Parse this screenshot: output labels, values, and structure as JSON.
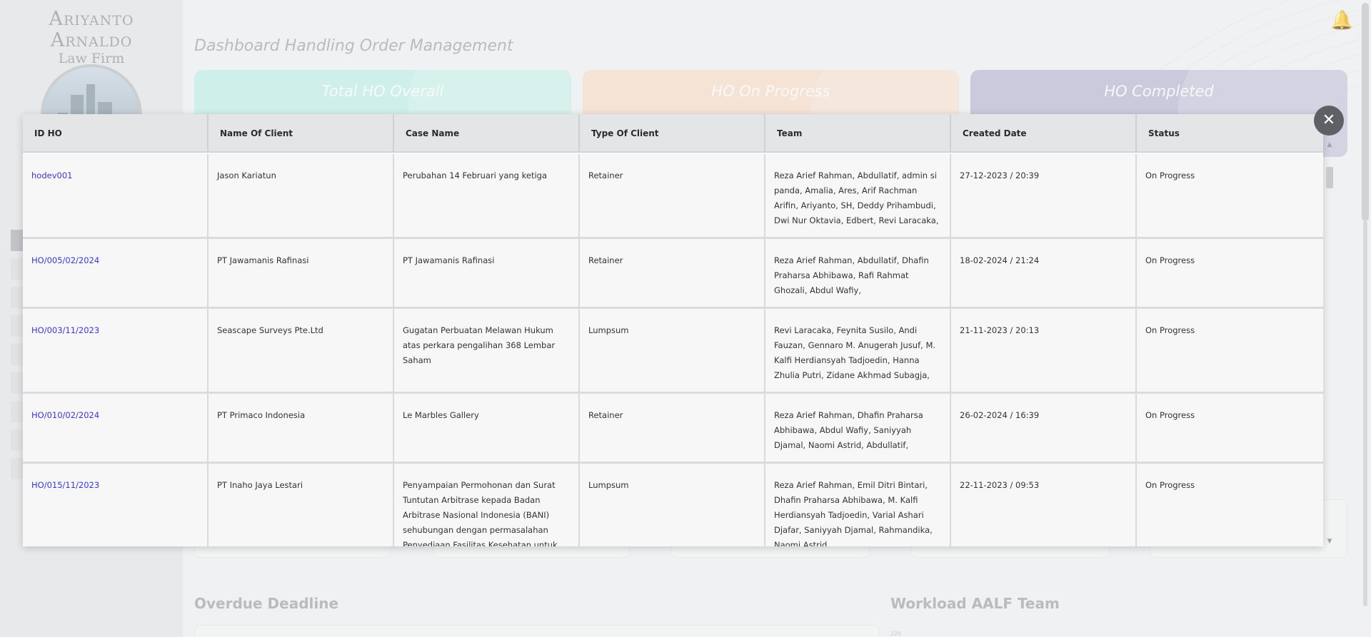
{
  "brand": {
    "line1": "Ariyanto Arnaldo",
    "line2": "Law Firm"
  },
  "page_title": "Dashboard Handling Order Management",
  "stat_cards": [
    {
      "label": "Total HO Overall"
    },
    {
      "label": "HO On Progress"
    },
    {
      "label": "HO Completed"
    }
  ],
  "sections": {
    "overdue": "Overdue Deadline",
    "workload": "Workload AALF Team",
    "axis_tick": "220"
  },
  "icons": {
    "bell": "bell-icon",
    "close": "close-icon"
  },
  "colors": {
    "link": "#3b36d6",
    "card_total": "#bdeee6",
    "card_progress": "#f7dcc8",
    "card_completed": "#b6b6d2",
    "bell": "#f1c75b"
  },
  "table": {
    "headers": [
      "ID HO",
      "Name Of Client",
      "Case Name",
      "Type Of Client",
      "Team",
      "Created Date",
      "Status"
    ],
    "rows": [
      {
        "id": "hodev001",
        "client": "Jason Kariatun",
        "case": "Perubahan 14 Februari yang ketiga",
        "type": "Retainer",
        "team": "Reza Arief Rahman, Abdullatif, admin si panda, Amalia, Ares, Arif Rachman Arifin, Ariyanto, SH, Deddy Prihambudi, Dwi Nur Oktavia, Edbert, Revi Laracaka,",
        "date": "27-12-2023 / 20:39",
        "status": "On Progress"
      },
      {
        "id": "HO/005/02/2024",
        "client": "PT Jawamanis Rafinasi",
        "case": "PT Jawamanis Rafinasi",
        "type": "Retainer",
        "team": "Reza Arief Rahman, Abdullatif, Dhafin Praharsa Abhibawa, Rafi Rahmat Ghozali, Abdul Wafiy,",
        "date": "18-02-2024 / 21:24",
        "status": "On Progress"
      },
      {
        "id": "HO/003/11/2023",
        "client": "Seascape Surveys Pte.Ltd",
        "case": "Gugatan Perbuatan Melawan Hukum atas perkara pengalihan 368 Lembar Saham",
        "type": "Lumpsum",
        "team": "Revi Laracaka, Feynita Susilo, Andi Fauzan, Gennaro M. Anugerah Jusuf, M. Kalfi Herdiansyah Tadjoedin, Hanna Zhulia Putri, Zidane Akhmad Subagja,",
        "date": "21-11-2023 / 20:13",
        "status": "On Progress"
      },
      {
        "id": "HO/010/02/2024",
        "client": "PT Primaco Indonesia",
        "case": "Le Marbles Gallery",
        "type": "Retainer",
        "team": "Reza Arief Rahman, Dhafin Praharsa Abhibawa, Abdul Wafiy, Saniyyah Djamal, Naomi Astrid, Abdullatif,",
        "date": "26-02-2024 / 16:39",
        "status": "On Progress"
      },
      {
        "id": "HO/015/11/2023",
        "client": "PT Inaho Jaya Lestari",
        "case": "Penyampaian Permohonan dan Surat Tuntutan Arbitrase kepada Badan Arbitrase Nasional Indonesia (BANI) sehubungan dengan permasalahan Penyediaan Fasilitas Kesehatan untuk",
        "type": "Lumpsum",
        "team": "Reza Arief Rahman, Emil Ditri Bintari, Dhafin Praharsa Abhibawa, M. Kalfi Herdiansyah Tadjoedin, Varial Ashari Djafar, Saniyyah Djamal, Rahmandika, Naomi Astrid,",
        "date": "22-11-2023 / 09:53",
        "status": "On Progress"
      }
    ]
  }
}
